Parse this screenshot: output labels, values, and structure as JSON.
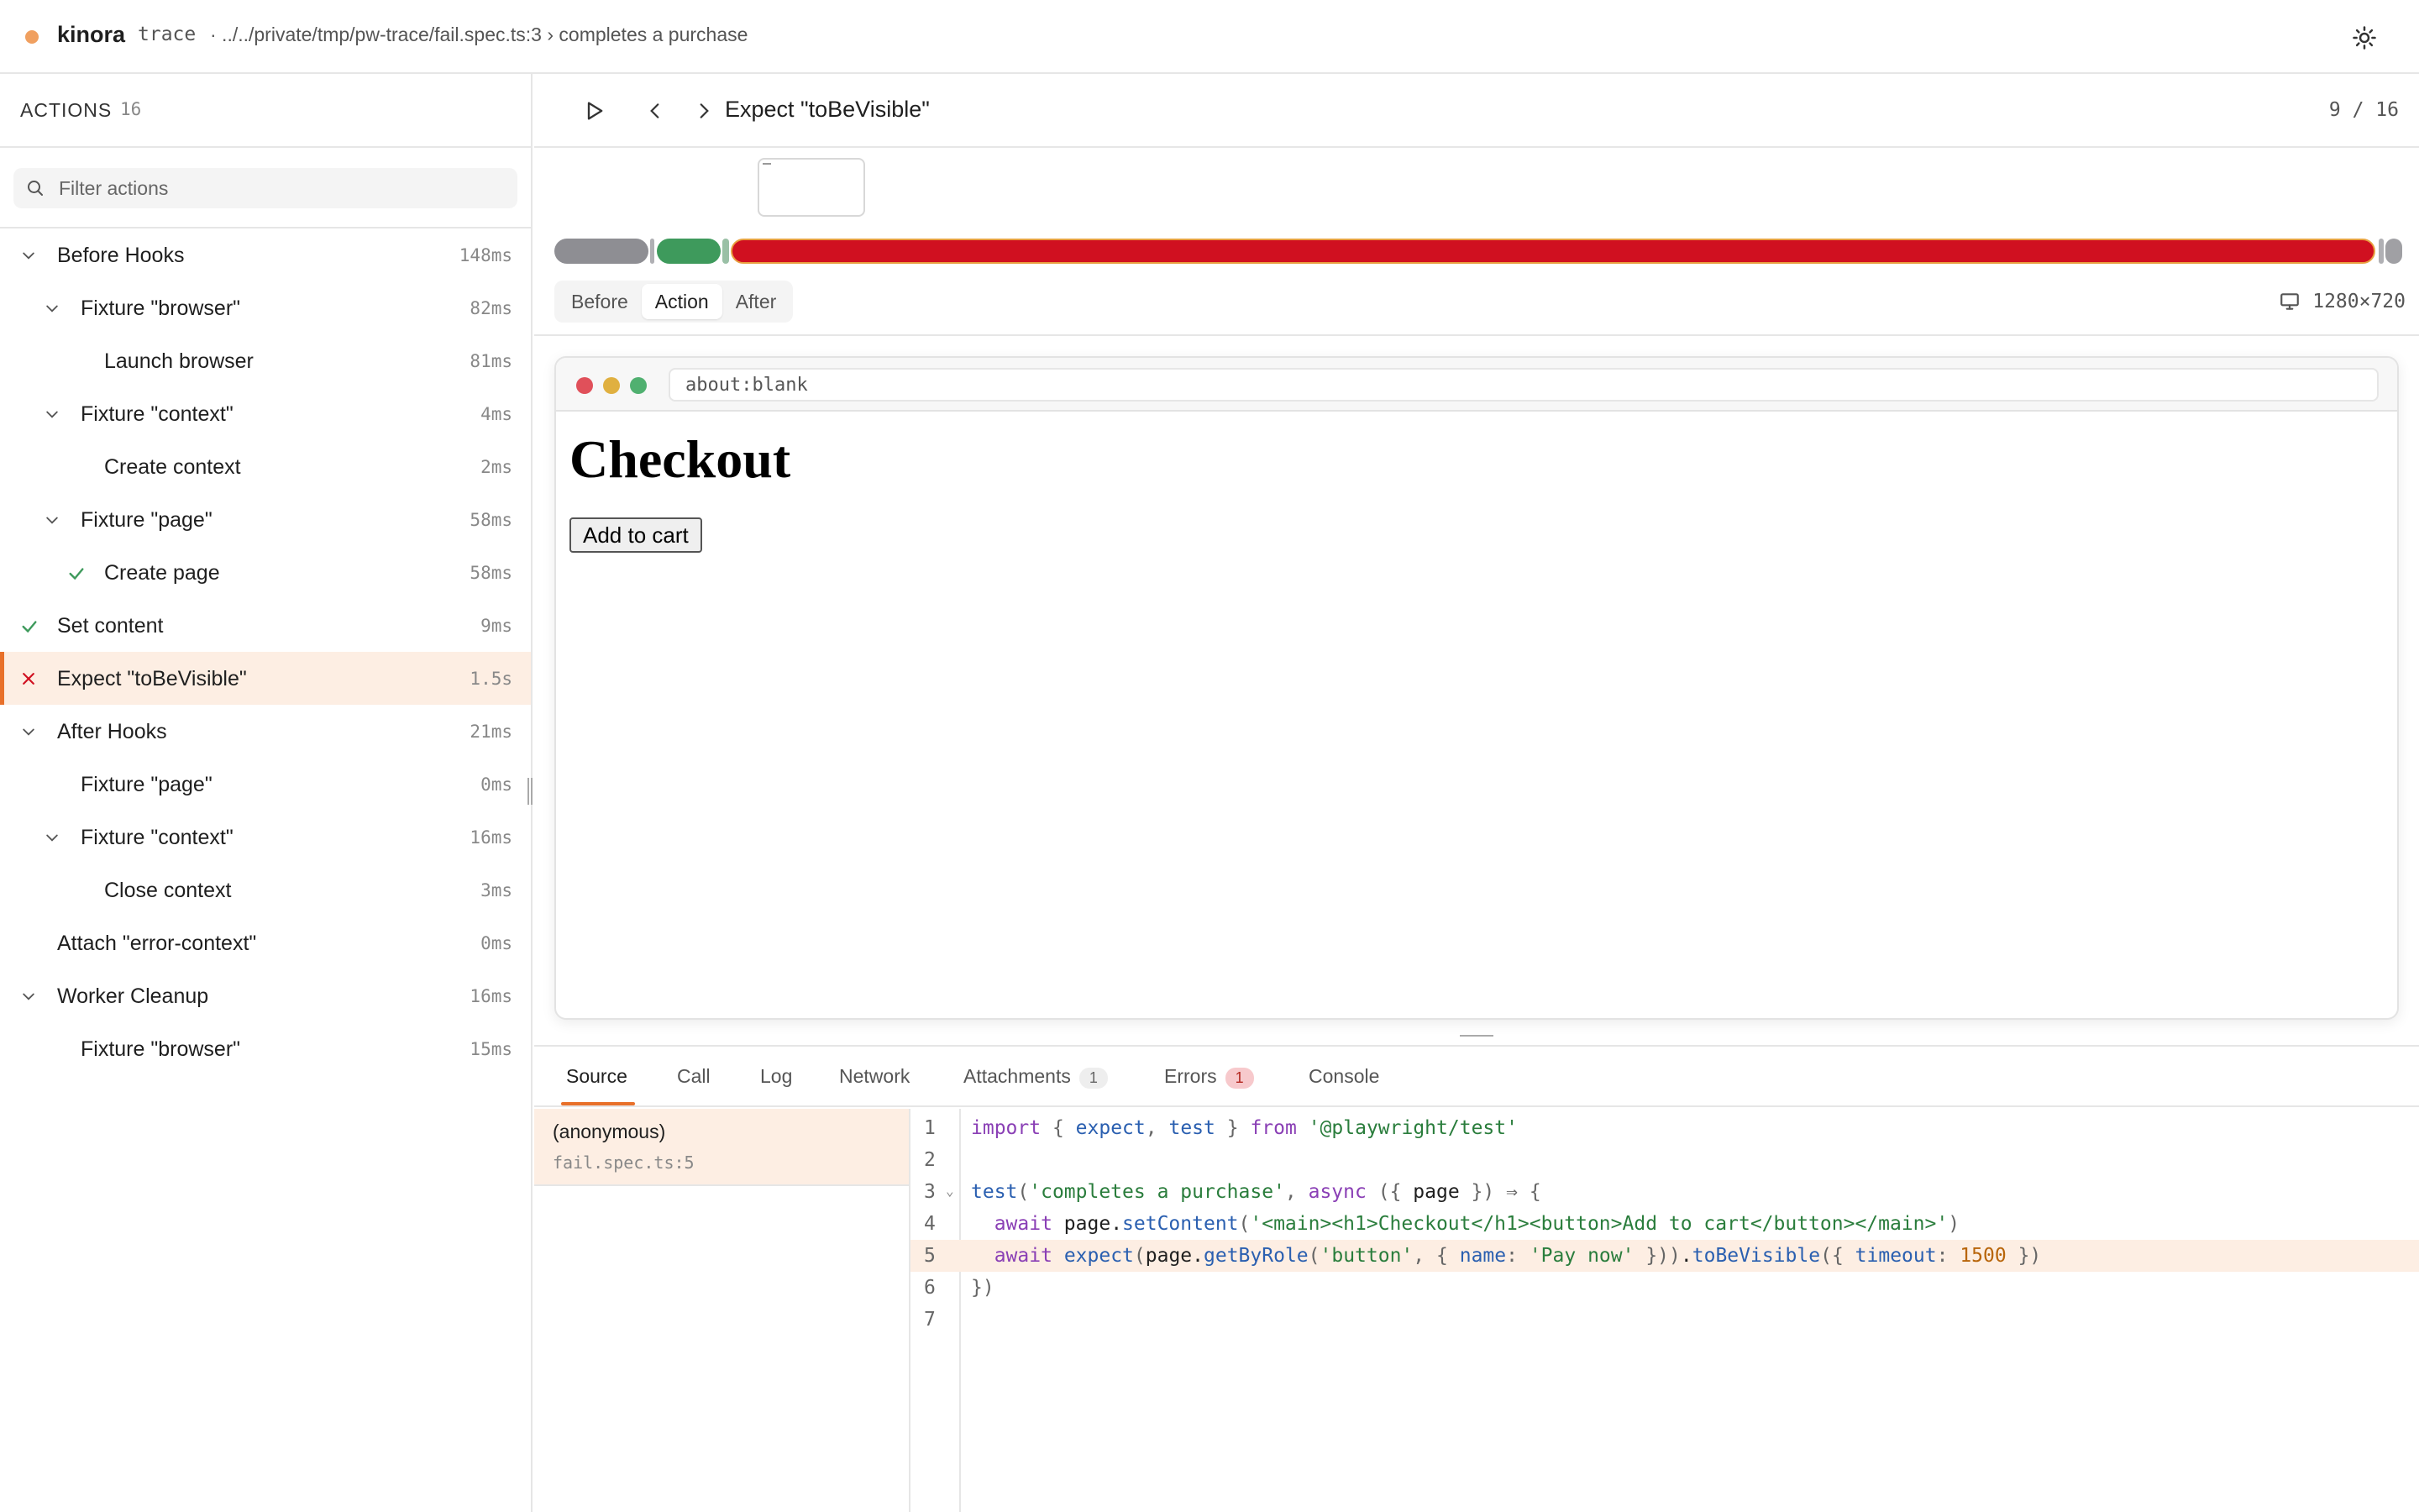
{
  "app": {
    "name": "kinora",
    "tag": "trace",
    "breadcrumb": "· ../../private/tmp/pw-trace/fail.spec.ts:3 › completes a purchase",
    "colors": {
      "accent": "#e8702a",
      "error": "#d01020",
      "success": "#3e9a5c"
    }
  },
  "sidebar": {
    "title": "ACTIONS",
    "count": "16",
    "filter_placeholder": "Filter actions",
    "items": [
      {
        "label": "Before Hooks",
        "duration": "148ms",
        "depth": 0,
        "icon": "chevron-down-icon"
      },
      {
        "label": "Fixture \"browser\"",
        "duration": "82ms",
        "depth": 1,
        "icon": "chevron-down-icon"
      },
      {
        "label": "Launch browser",
        "duration": "81ms",
        "depth": 2,
        "icon": ""
      },
      {
        "label": "Fixture \"context\"",
        "duration": "4ms",
        "depth": 1,
        "icon": "chevron-down-icon"
      },
      {
        "label": "Create context",
        "duration": "2ms",
        "depth": 2,
        "icon": ""
      },
      {
        "label": "Fixture \"page\"",
        "duration": "58ms",
        "depth": 1,
        "icon": "chevron-down-icon"
      },
      {
        "label": "Create page",
        "duration": "58ms",
        "depth": 2,
        "icon": "check-icon"
      },
      {
        "label": "Set content",
        "duration": "9ms",
        "depth": 0,
        "icon": "check-icon"
      },
      {
        "label": "Expect \"toBeVisible\"",
        "duration": "1.5s",
        "depth": 0,
        "icon": "x-icon",
        "selected": true
      },
      {
        "label": "After Hooks",
        "duration": "21ms",
        "depth": 0,
        "icon": "chevron-down-icon"
      },
      {
        "label": "Fixture \"page\"",
        "duration": "0ms",
        "depth": 1,
        "icon": ""
      },
      {
        "label": "Fixture \"context\"",
        "duration": "16ms",
        "depth": 1,
        "icon": "chevron-down-icon"
      },
      {
        "label": "Close context",
        "duration": "3ms",
        "depth": 2,
        "icon": ""
      },
      {
        "label": "Attach \"error-context\"",
        "duration": "0ms",
        "depth": 0,
        "icon": ""
      },
      {
        "label": "Worker Cleanup",
        "duration": "16ms",
        "depth": 0,
        "icon": "chevron-down-icon"
      },
      {
        "label": "Fixture \"browser\"",
        "duration": "15ms",
        "depth": 1,
        "icon": ""
      }
    ]
  },
  "toolbar": {
    "title": "Expect \"toBeVisible\"",
    "counter": "9  /  16"
  },
  "snapshot": {
    "tabs": [
      "Before",
      "Action",
      "After"
    ],
    "active_tab": "Action",
    "viewport": "1280×720",
    "url": "about:blank",
    "page_heading": "Checkout",
    "page_button": "Add to cart"
  },
  "panel": {
    "tabs": [
      {
        "label": "Source",
        "badge": ""
      },
      {
        "label": "Call",
        "badge": ""
      },
      {
        "label": "Log",
        "badge": ""
      },
      {
        "label": "Network",
        "badge": ""
      },
      {
        "label": "Attachments",
        "badge": "1"
      },
      {
        "label": "Errors",
        "badge": "1"
      },
      {
        "label": "Console",
        "badge": ""
      }
    ],
    "active_tab": "Source",
    "stack": {
      "function": "(anonymous)",
      "location": "fail.spec.ts:5"
    },
    "highlight_line": 5,
    "line_numbers": [
      "1",
      "2",
      "3",
      "4",
      "5",
      "6",
      "7"
    ],
    "source_lines": [
      "import { expect, test } from '@playwright/test'",
      "",
      "test('completes a purchase', async ({ page }) ⇒ {",
      "  await page.setContent('<main><h1>Checkout</h1><button>Add to cart</button></main>')",
      "  await expect(page.getByRole('button', { name: 'Pay now' })).toBeVisible({ timeout: 1500 })",
      "})",
      ""
    ]
  }
}
